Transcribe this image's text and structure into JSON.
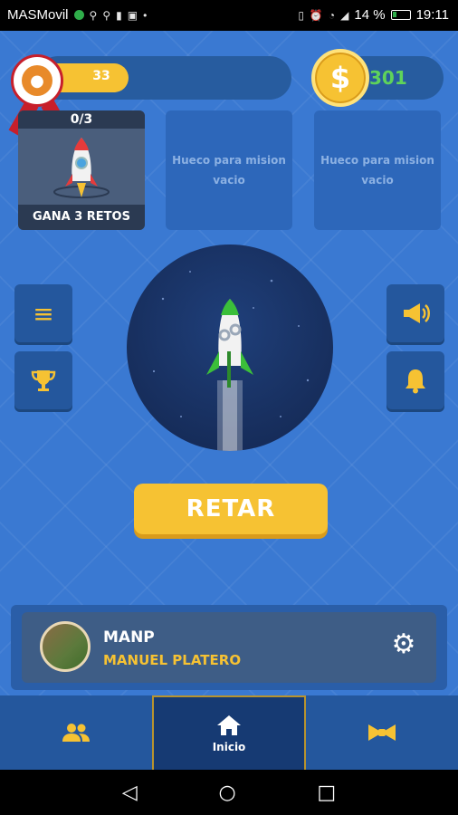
{
  "status_bar": {
    "carrier": "MASMovil",
    "battery": "14 %",
    "time": "19:11"
  },
  "xp": {
    "value": "33",
    "level_fraction": 0.36,
    "badge_icon": "medal-icon"
  },
  "coins": {
    "value": "301",
    "icon": "coin-icon"
  },
  "missions": [
    {
      "progress": "0/3",
      "label": "GANA 3 RETOS",
      "icon": "rocket-icon"
    },
    {
      "label": "Hueco para mision vacio"
    },
    {
      "label": "Hueco para mision vacio"
    }
  ],
  "side_buttons": {
    "left": [
      "menu-icon",
      "trophy-icon"
    ],
    "right": [
      "megaphone-icon",
      "bell-icon"
    ]
  },
  "challenge_button": {
    "label": "RETAR"
  },
  "profile": {
    "nickname": "MANP",
    "full_name": "MANUEL PLATERO"
  },
  "bottom_nav": {
    "items": [
      {
        "icon": "friends-icon"
      },
      {
        "icon": "home-icon",
        "label": "Inicio"
      },
      {
        "icon": "bowtie-icon"
      }
    ]
  },
  "colors": {
    "background": "#3a79d2",
    "accent": "#f6c233",
    "coin_text": "#5fd35a"
  }
}
